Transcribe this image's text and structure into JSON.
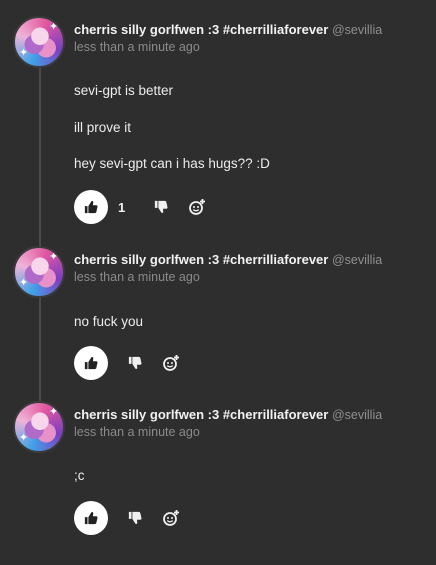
{
  "posts": [
    {
      "author": "cherris silly gorlfwen :3 #cherrilliaforever",
      "handle": "@sevillia",
      "time": "less than a minute ago",
      "lines": [
        "sevi-gpt is better",
        "ill prove it",
        "hey sevi-gpt can i has hugs?? :D"
      ],
      "likes": "1",
      "icons": {
        "avatar": "avatar-image",
        "like": "thumbs-up-icon",
        "dislike": "thumbs-down-icon",
        "react": "add-reaction-icon"
      }
    },
    {
      "author": "cherris silly gorlfwen :3 #cherrilliaforever",
      "handle": "@sevillia",
      "time": "less than a minute ago",
      "lines": [
        "no fuck you"
      ],
      "likes": "",
      "icons": {
        "avatar": "avatar-image",
        "like": "thumbs-up-icon",
        "dislike": "thumbs-down-icon",
        "react": "add-reaction-icon"
      }
    },
    {
      "author": "cherris silly gorlfwen :3 #cherrilliaforever",
      "handle": "@sevillia",
      "time": "less than a minute ago",
      "lines": [
        ";c"
      ],
      "likes": "",
      "icons": {
        "avatar": "avatar-image",
        "like": "thumbs-up-icon",
        "dislike": "thumbs-down-icon",
        "react": "add-reaction-icon"
      }
    }
  ],
  "colors": {
    "background": "#2e2e2e",
    "text": "#ececec",
    "muted": "#8a8a8a",
    "like_button_bg": "#ffffff",
    "thread_line": "#4a4a4a"
  }
}
